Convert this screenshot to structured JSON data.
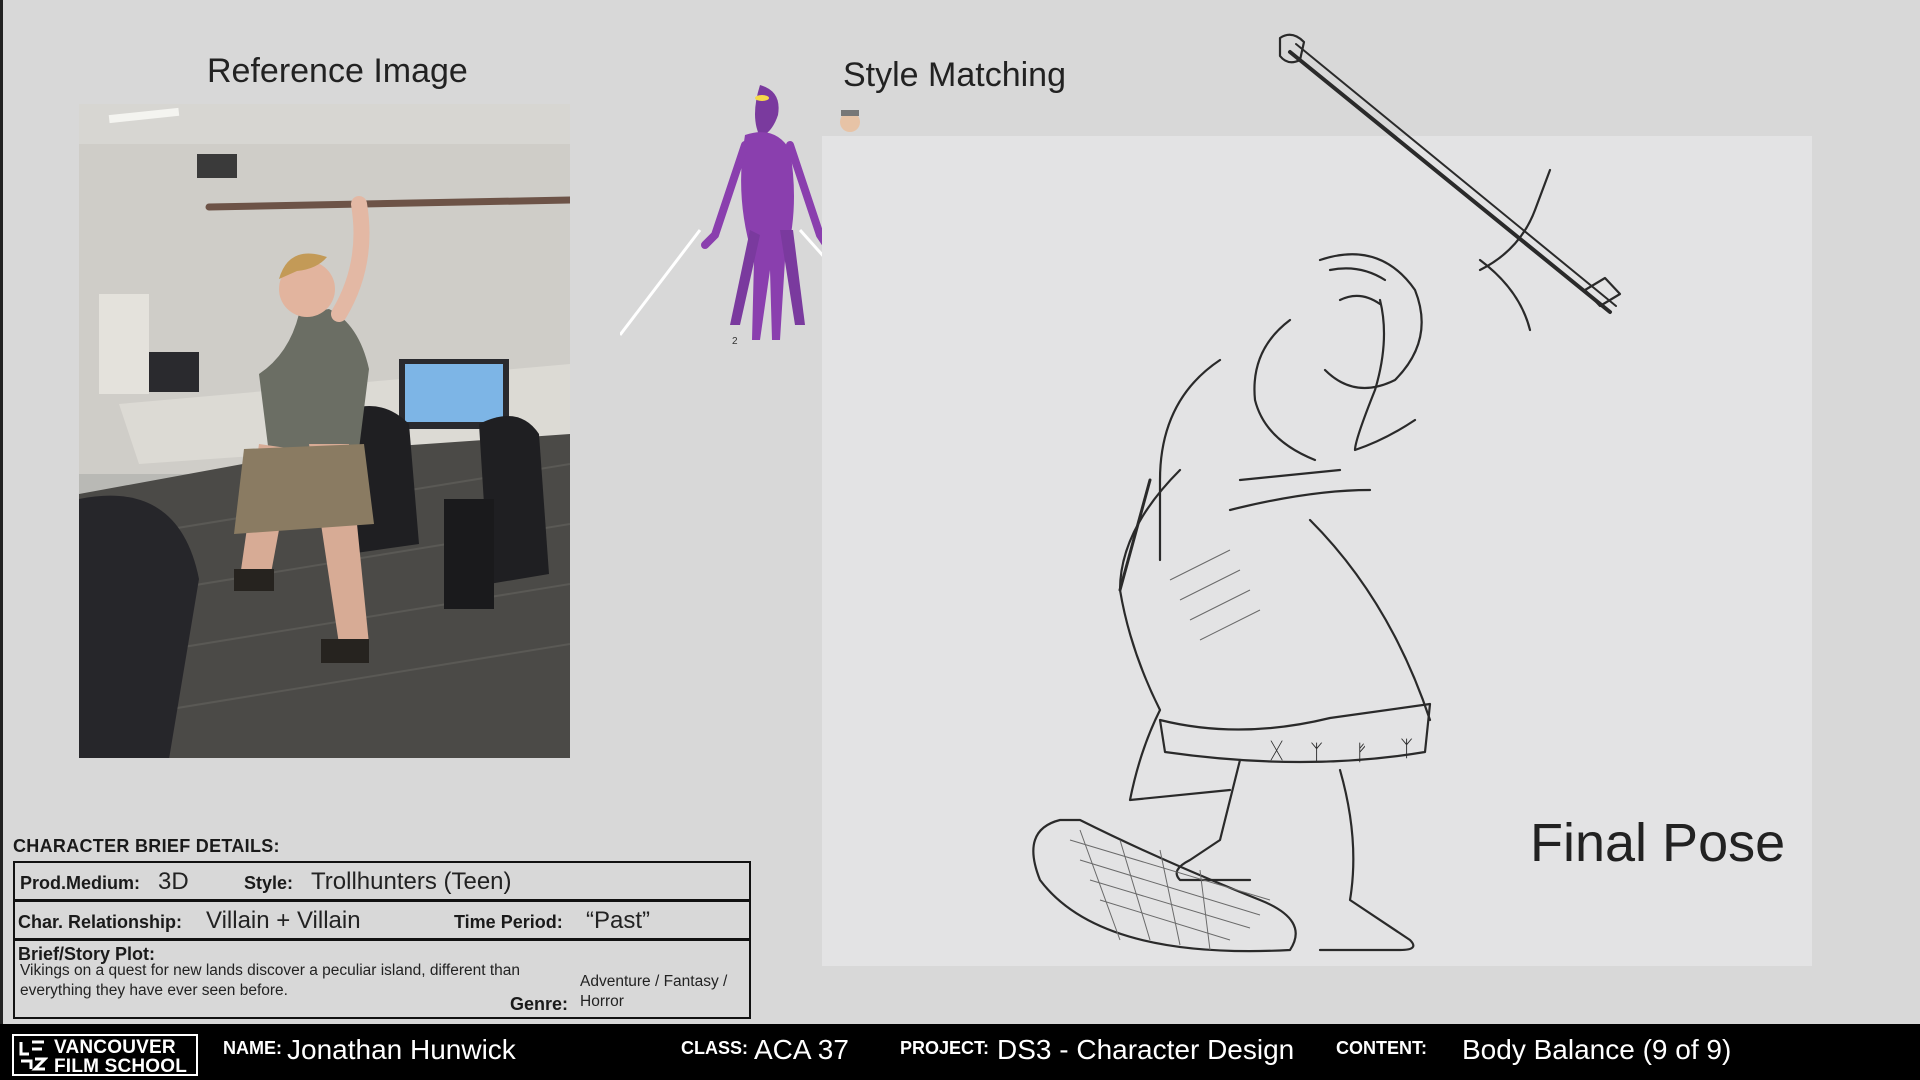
{
  "headings": {
    "reference": "Reference Image",
    "style": "Style Matching",
    "final": "Final Pose"
  },
  "style_strip": {
    "page_number": "2"
  },
  "final_pose": {
    "runes": [
      "ᚷ",
      "ᛉ",
      "ᚠ",
      "ᛉ"
    ]
  },
  "brief": {
    "heading": "CHARACTER BRIEF DETAILS:",
    "prod_medium_label": "Prod.Medium:",
    "prod_medium": "3D",
    "style_label": "Style:",
    "style": "Trollhunters (Teen)",
    "relationship_label": "Char. Relationship:",
    "relationship": "Villain + Villain",
    "time_period_label": "Time Period:",
    "time_period": "“Past”",
    "plot_label": "Brief/Story Plot:",
    "plot_line1": "Vikings on a quest for new lands discover a peculiar island, different than",
    "plot_line2": "everything they have ever seen before.",
    "genre_label": "Genre:",
    "genre_line1": "Adventure / Fantasy /",
    "genre_line2": "Horror"
  },
  "footer": {
    "logo_line1": "VANCOUVER",
    "logo_line2": "FILM SCHOOL",
    "name_label": "NAME:",
    "name": "Jonathan Hunwick",
    "class_label": "CLASS:",
    "class": "ACA 37",
    "project_label": "PROJECT:",
    "project": "DS3 - Character Design",
    "content_label": "CONTENT:",
    "content": "Body Balance (9 of 9)"
  },
  "colors": {
    "background": "#d8d8d8",
    "canvas": "#e3e3e4",
    "footer": "#000000",
    "villain_purple": "#8a3fae",
    "ink": "#222222"
  }
}
